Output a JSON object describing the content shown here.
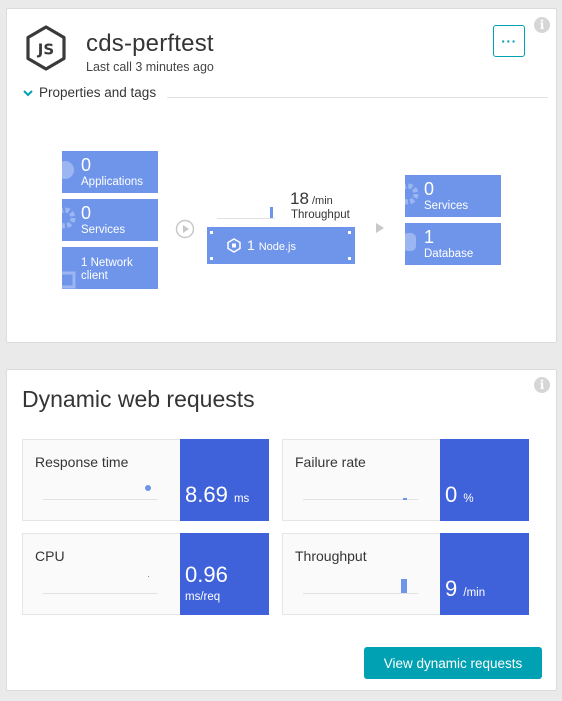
{
  "header": {
    "title": "cds-perftest",
    "last_call": "Last call 3 minutes ago",
    "more_label": "···",
    "properties_label": "Properties and tags"
  },
  "topology": {
    "applications": {
      "count": "0",
      "label": "Applications"
    },
    "services_in": {
      "count": "0",
      "label": "Services"
    },
    "network_client": {
      "label_line1": "1 Network",
      "label_line2": "client"
    },
    "throughput": {
      "value": "18",
      "unit": "/min",
      "label": "Throughput"
    },
    "process": {
      "count": "1",
      "label": "Node.js"
    },
    "services_out": {
      "count": "0",
      "label": "Services"
    },
    "database": {
      "count": "1",
      "label": "Database"
    }
  },
  "dynamic_web_requests": {
    "title": "Dynamic web requests",
    "metrics": {
      "response_time": {
        "label": "Response time",
        "value": "8.69",
        "unit": "ms"
      },
      "failure_rate": {
        "label": "Failure rate",
        "value": "0",
        "unit": "%"
      },
      "cpu": {
        "label": "CPU",
        "value": "0.96",
        "unit": "ms/req"
      },
      "throughput": {
        "label": "Throughput",
        "value": "9",
        "unit": "/min"
      }
    },
    "view_button": "View dynamic requests"
  },
  "info_icon_glyph": "i",
  "colors": {
    "tile_blue": "#6f95ea",
    "value_blue": "#3f61d9",
    "accent_teal": "#00a1b2"
  }
}
